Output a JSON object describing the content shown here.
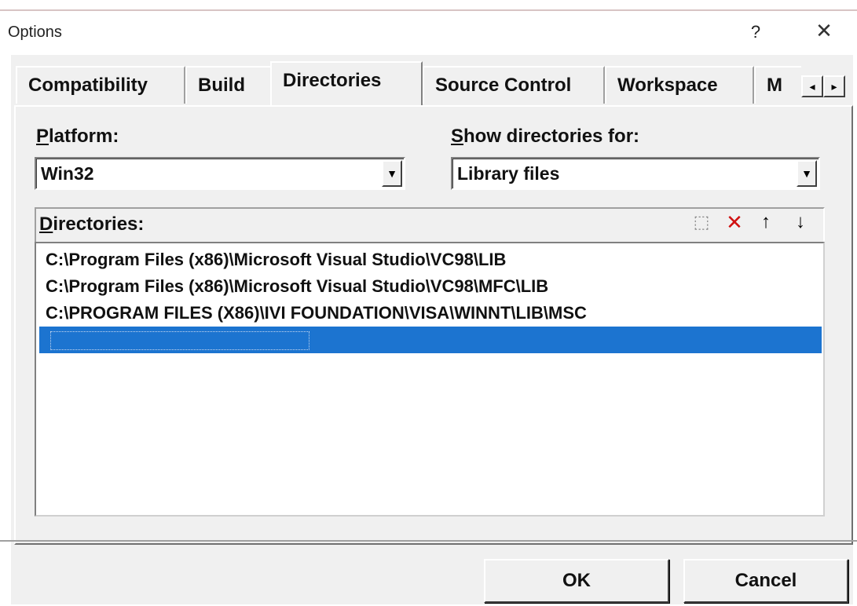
{
  "window": {
    "title": "Options",
    "help_label": "?",
    "close_label": "✕"
  },
  "tabs": [
    {
      "label": "Compatibility"
    },
    {
      "label": "Build"
    },
    {
      "label": "Directories"
    },
    {
      "label": "Source Control"
    },
    {
      "label": "Workspace"
    },
    {
      "label": "M"
    }
  ],
  "active_tab": "Directories",
  "tab_scroll": {
    "left": "◂",
    "right": "▸"
  },
  "platform": {
    "label_first": "P",
    "label_rest": "latform:",
    "value": "Win32"
  },
  "show_dirs": {
    "label_first": "S",
    "label_rest": "how directories for:",
    "value": "Library files"
  },
  "directories": {
    "label_first": "D",
    "label_rest": "irectories:",
    "items": [
      "C:\\Program Files (x86)\\Microsoft Visual Studio\\VC98\\LIB",
      "C:\\Program Files (x86)\\Microsoft Visual Studio\\VC98\\MFC\\LIB",
      "C:\\PROGRAM FILES (X86)\\IVI FOUNDATION\\VISA\\WINNT\\LIB\\MSC"
    ],
    "tools": {
      "new": "⬚",
      "delete": "✕",
      "up": "↑",
      "down": "↓"
    }
  },
  "buttons": {
    "ok": "OK",
    "cancel": "Cancel"
  },
  "colors": {
    "dialog_bg": "#f0f0f0",
    "selection": "#1c74d0",
    "delete_red": "#d01010"
  }
}
